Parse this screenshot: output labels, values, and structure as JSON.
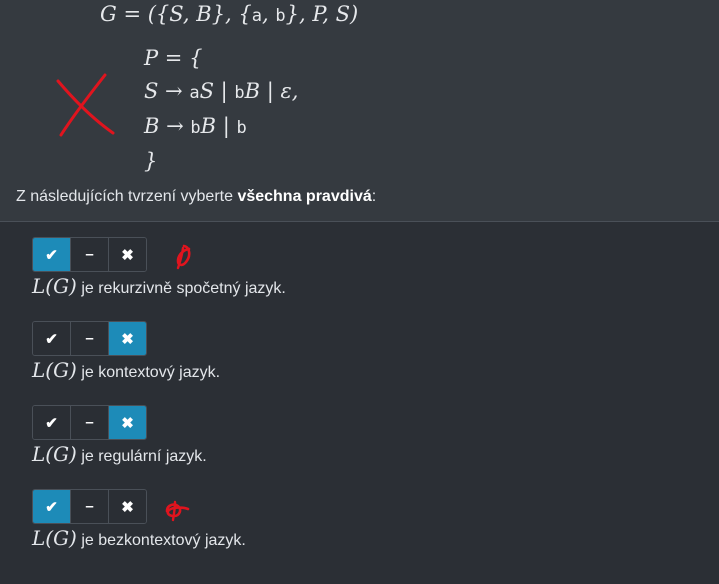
{
  "grammar": {
    "definition": "G = ({S, B}, {a, b}, P, S)",
    "rules": [
      "P = {",
      "S → aS | bB | ε,",
      "B → bB | b",
      "}"
    ]
  },
  "question": {
    "prefix": "Z následujících tvrzení vyberte ",
    "emphasis": "všechna pravdivá",
    "suffix": ":"
  },
  "buttons": {
    "yes": "✔",
    "neutral": "–",
    "no": "✖"
  },
  "statements": [
    {
      "lhs": "L(G)",
      "text": " je rekurzivně spočetný jazyk.",
      "selected": "yes"
    },
    {
      "lhs": "L(G)",
      "text": " je kontextový jazyk.",
      "selected": "no"
    },
    {
      "lhs": "L(G)",
      "text": " je regulární jazyk.",
      "selected": "no"
    },
    {
      "lhs": "L(G)",
      "text": " je bezkontextový jazyk.",
      "selected": "yes"
    }
  ],
  "colors": {
    "active": "#1d8bb8",
    "annotation": "#e0141e"
  }
}
